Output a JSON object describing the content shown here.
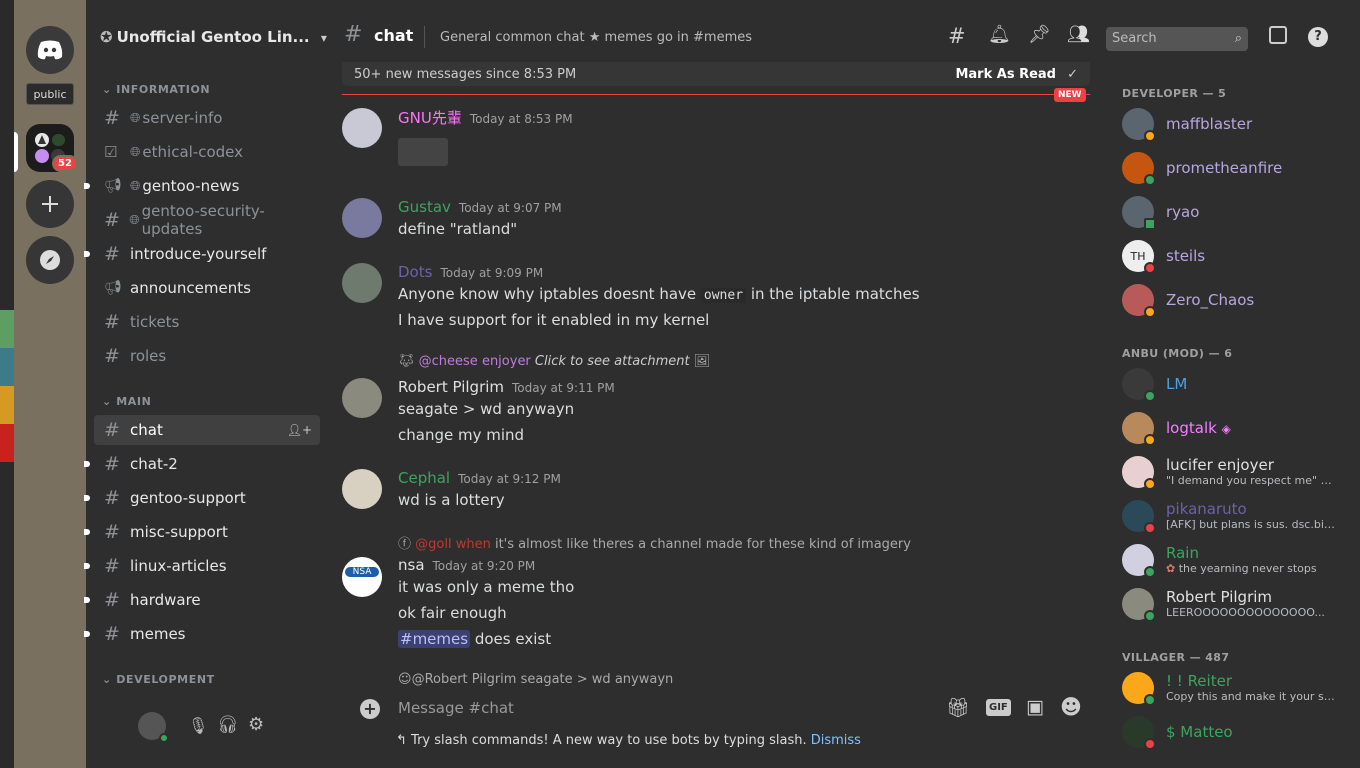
{
  "rail": {
    "tooltip": "public",
    "badge": "52"
  },
  "server": {
    "name": "Unofficial Gentoo Lin..."
  },
  "categories": {
    "information": "INFORMATION",
    "main": "MAIN",
    "development": "DEVELOPMENT"
  },
  "info_channels": [
    {
      "label": "server-info"
    },
    {
      "label": "ethical-codex"
    },
    {
      "label": "gentoo-news"
    },
    {
      "label": "gentoo-security-updates"
    },
    {
      "label": "introduce-yourself"
    },
    {
      "label": "announcements"
    },
    {
      "label": "tickets"
    },
    {
      "label": "roles"
    }
  ],
  "main_channels": [
    {
      "label": "chat"
    },
    {
      "label": "chat-2"
    },
    {
      "label": "gentoo-support"
    },
    {
      "label": "misc-support"
    },
    {
      "label": "linux-articles"
    },
    {
      "label": "hardware"
    },
    {
      "label": "memes"
    }
  ],
  "header": {
    "channel": "chat",
    "topic": "General common chat ★ memes go in #memes",
    "search_placeholder": "Search"
  },
  "newbar": {
    "text": "50+ new messages since 8:53 PM",
    "mark": "Mark As Read",
    "tag": "NEW"
  },
  "messages": {
    "m1": {
      "user": "GNU先輩",
      "time": "Today at 8:53 PM"
    },
    "m2": {
      "user": "Gustav",
      "time": "Today at 9:07 PM",
      "line1": "define \"ratland\""
    },
    "m3": {
      "user": "Dots",
      "time": "Today at 9:09 PM",
      "line1a": "Anyone know why iptables doesnt have",
      "code": "owner",
      "line1b": "in the iptable matches",
      "line2": "I have support for it enabled in my kernel"
    },
    "m4": {
      "reply_user": "@cheese enjoyer",
      "reply_text": "Click to see attachment",
      "user": "Robert Pilgrim",
      "time": "Today at 9:11 PM",
      "line1": "seagate > wd anywayn",
      "line2": "change my mind"
    },
    "m5": {
      "user": "Cephal",
      "time": "Today at 9:12 PM",
      "line1": "wd is a lottery"
    },
    "m6": {
      "reply_user": "@goll when",
      "reply_text": "it's almost like theres a channel made for these kind of imagery",
      "user": "nsa",
      "time": "Today at 9:20 PM",
      "line1": "it was only a meme tho",
      "line2": "ok fair enough",
      "mention": "#memes",
      "line3b": "does exist"
    },
    "m7": {
      "reply_user": "@Robert Pilgrim",
      "reply_text": "seagate > wd anywayn"
    }
  },
  "composer": {
    "placeholder": "Message #chat",
    "hint": "Try slash commands! A new way to use bots by typing slash.",
    "dismiss": "Dismiss"
  },
  "members": {
    "developer_header": "DEVELOPER — 5",
    "developers": [
      {
        "name": "maffblaster"
      },
      {
        "name": "prometheanfire"
      },
      {
        "name": "ryao"
      },
      {
        "name": "steils"
      },
      {
        "name": "Zero_Chaos"
      }
    ],
    "anbu_header": "ANBU (MOD) — 6",
    "anbu": [
      {
        "name": "LM",
        "status": ""
      },
      {
        "name": "logtalk",
        "status": ""
      },
      {
        "name": "lucifer enjoyer",
        "status": "\"I demand you respect me\" we..."
      },
      {
        "name": "pikanaruto",
        "status": "[AFK] but plans is sus. dsc.bio..."
      },
      {
        "name": "Rain",
        "status": "the yearning never stops"
      },
      {
        "name": "Robert Pilgrim",
        "status": "LEEROOOOOOOOOOOOOO..."
      }
    ],
    "villager_header": "VILLAGER — 487",
    "villagers": [
      {
        "name": "! ! Reiter",
        "status": "Copy this and make it your sta..."
      },
      {
        "name": "$ Matteo",
        "status": ""
      }
    ]
  },
  "colors": {
    "accent": "#ed4245",
    "online": "#3ba55d",
    "idle": "#faa81a",
    "dnd": "#ed4245"
  }
}
